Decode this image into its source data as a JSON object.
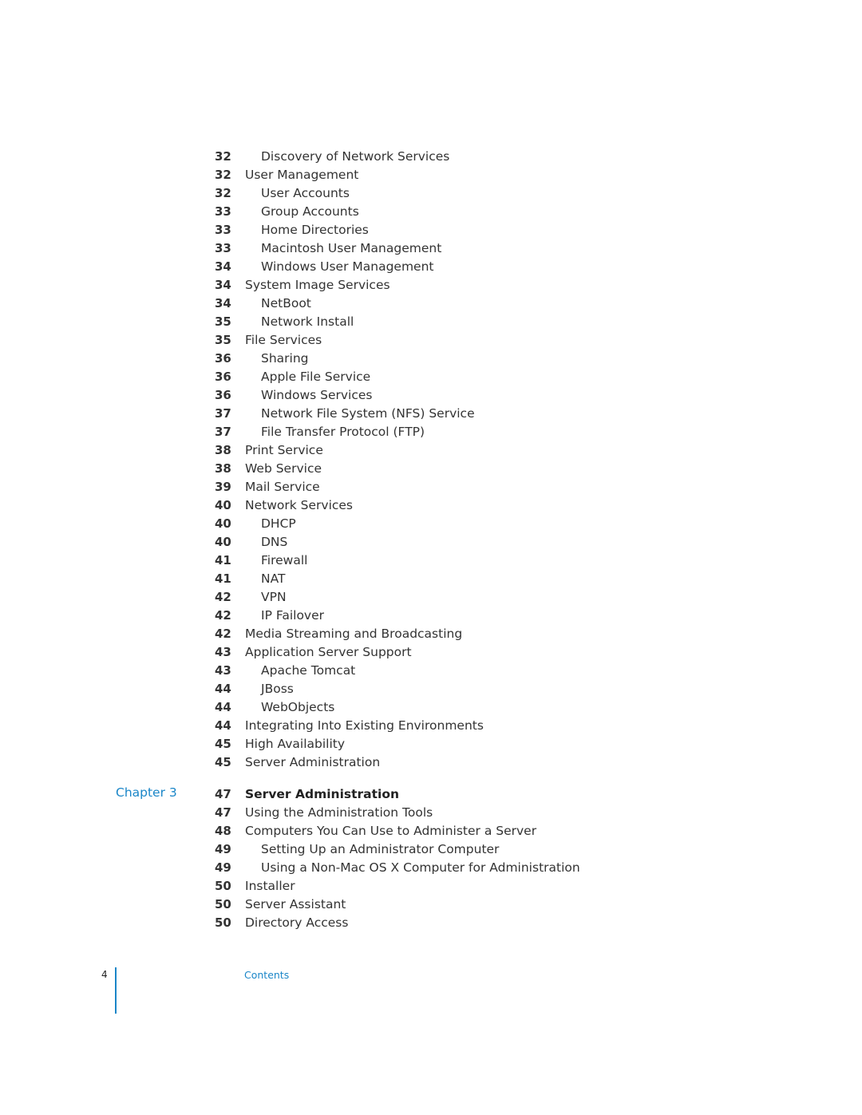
{
  "toc": {
    "part1": [
      {
        "page": "32",
        "title": "Discovery of Network Services",
        "level": 2
      },
      {
        "page": "32",
        "title": "User Management",
        "level": 1
      },
      {
        "page": "32",
        "title": "User Accounts",
        "level": 2
      },
      {
        "page": "33",
        "title": "Group Accounts",
        "level": 2
      },
      {
        "page": "33",
        "title": "Home Directories",
        "level": 2
      },
      {
        "page": "33",
        "title": "Macintosh User Management",
        "level": 2
      },
      {
        "page": "34",
        "title": "Windows User Management",
        "level": 2
      },
      {
        "page": "34",
        "title": "System Image Services",
        "level": 1
      },
      {
        "page": "34",
        "title": "NetBoot",
        "level": 2
      },
      {
        "page": "35",
        "title": "Network Install",
        "level": 2
      },
      {
        "page": "35",
        "title": "File Services",
        "level": 1
      },
      {
        "page": "36",
        "title": "Sharing",
        "level": 2
      },
      {
        "page": "36",
        "title": "Apple File Service",
        "level": 2
      },
      {
        "page": "36",
        "title": "Windows Services",
        "level": 2
      },
      {
        "page": "37",
        "title": "Network File System (NFS) Service",
        "level": 2
      },
      {
        "page": "37",
        "title": "File Transfer Protocol (FTP)",
        "level": 2
      },
      {
        "page": "38",
        "title": "Print Service",
        "level": 1
      },
      {
        "page": "38",
        "title": "Web Service",
        "level": 1
      },
      {
        "page": "39",
        "title": "Mail Service",
        "level": 1
      },
      {
        "page": "40",
        "title": "Network Services",
        "level": 1
      },
      {
        "page": "40",
        "title": "DHCP",
        "level": 2
      },
      {
        "page": "40",
        "title": "DNS",
        "level": 2
      },
      {
        "page": "41",
        "title": "Firewall",
        "level": 2
      },
      {
        "page": "41",
        "title": "NAT",
        "level": 2
      },
      {
        "page": "42",
        "title": "VPN",
        "level": 2
      },
      {
        "page": "42",
        "title": "IP Failover",
        "level": 2
      },
      {
        "page": "42",
        "title": "Media Streaming and Broadcasting",
        "level": 1
      },
      {
        "page": "43",
        "title": "Application Server Support",
        "level": 1
      },
      {
        "page": "43",
        "title": "Apache Tomcat",
        "level": 2
      },
      {
        "page": "44",
        "title": "JBoss",
        "level": 2
      },
      {
        "page": "44",
        "title": "WebObjects",
        "level": 2
      },
      {
        "page": "44",
        "title": "Integrating Into Existing Environments",
        "level": 1
      },
      {
        "page": "45",
        "title": "High Availability",
        "level": 1
      },
      {
        "page": "45",
        "title": "Server Administration",
        "level": 1
      }
    ],
    "chapter3": {
      "label": "Chapter 3",
      "entries": [
        {
          "page": "47",
          "title": "Server Administration",
          "level": 0
        },
        {
          "page": "47",
          "title": "Using the Administration Tools",
          "level": 1
        },
        {
          "page": "48",
          "title": "Computers You Can Use to Administer a Server",
          "level": 1
        },
        {
          "page": "49",
          "title": "Setting Up an Administrator Computer",
          "level": 2
        },
        {
          "page": "49",
          "title": "Using a Non-Mac OS X Computer for Administration",
          "level": 2
        },
        {
          "page": "50",
          "title": "Installer",
          "level": 1
        },
        {
          "page": "50",
          "title": "Server Assistant",
          "level": 1
        },
        {
          "page": "50",
          "title": "Directory Access",
          "level": 1
        }
      ]
    }
  },
  "footer": {
    "page_number": "4",
    "section_label": "Contents"
  },
  "colors": {
    "accent": "#1a86c8"
  }
}
